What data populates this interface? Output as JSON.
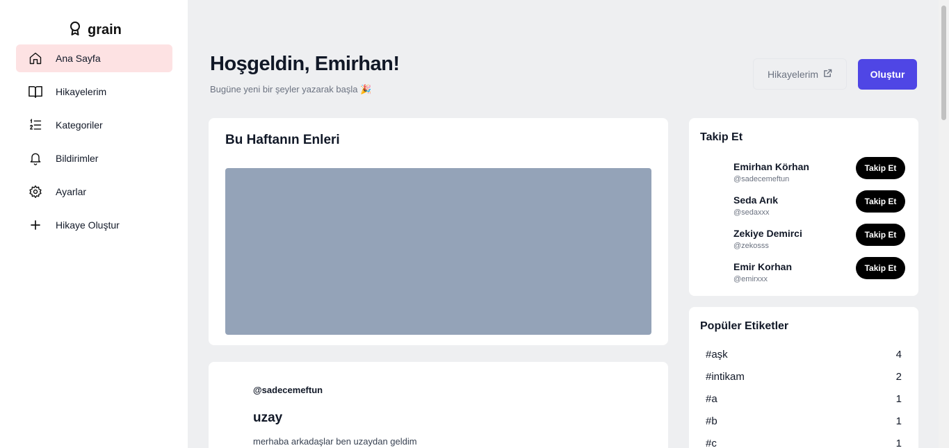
{
  "app": {
    "logo_text": "grain"
  },
  "sidebar": {
    "items": [
      {
        "label": "Ana Sayfa",
        "icon": "home-icon",
        "active": true
      },
      {
        "label": "Hikayelerim",
        "icon": "book-icon"
      },
      {
        "label": "Kategoriler",
        "icon": "list-icon"
      },
      {
        "label": "Bildirimler",
        "icon": "bell-icon"
      },
      {
        "label": "Ayarlar",
        "icon": "gear-icon"
      },
      {
        "label": "Hikaye Oluştur",
        "icon": "plus-icon"
      }
    ]
  },
  "header": {
    "greeting": "Hoşgeldin, Emirhan!",
    "subtitle": "Bugüne yeni bir şeyler yazarak başla 🎉",
    "stories_button": "Hikayelerim",
    "create_button": "Oluştur"
  },
  "weekly": {
    "title": "Bu Haftanın Enleri"
  },
  "story": {
    "author": "@sadecemeftun",
    "title": "uzay",
    "body": "merhaba arkadaşlar ben uzaydan geldim"
  },
  "follow": {
    "title": "Takip Et",
    "button_label": "Takip Et",
    "users": [
      {
        "name": "Emirhan Körhan",
        "handle": "@sadecemeftun"
      },
      {
        "name": "Seda Arık",
        "handle": "@sedaxxx"
      },
      {
        "name": "Zekiye Demirci",
        "handle": "@zekosss"
      },
      {
        "name": "Emir Korhan",
        "handle": "@emirxxx"
      }
    ]
  },
  "tags": {
    "title": "Popüler Etiketler",
    "items": [
      {
        "tag": "#aşk",
        "count": "4"
      },
      {
        "tag": "#intikam",
        "count": "2"
      },
      {
        "tag": "#a",
        "count": "1"
      },
      {
        "tag": "#b",
        "count": "1"
      },
      {
        "tag": "#c",
        "count": "1"
      }
    ]
  },
  "colors": {
    "accent": "#4f46e5",
    "active_nav_bg": "#fde2e3",
    "page_bg": "#eeeff1",
    "image_placeholder": "#94a3b8"
  }
}
